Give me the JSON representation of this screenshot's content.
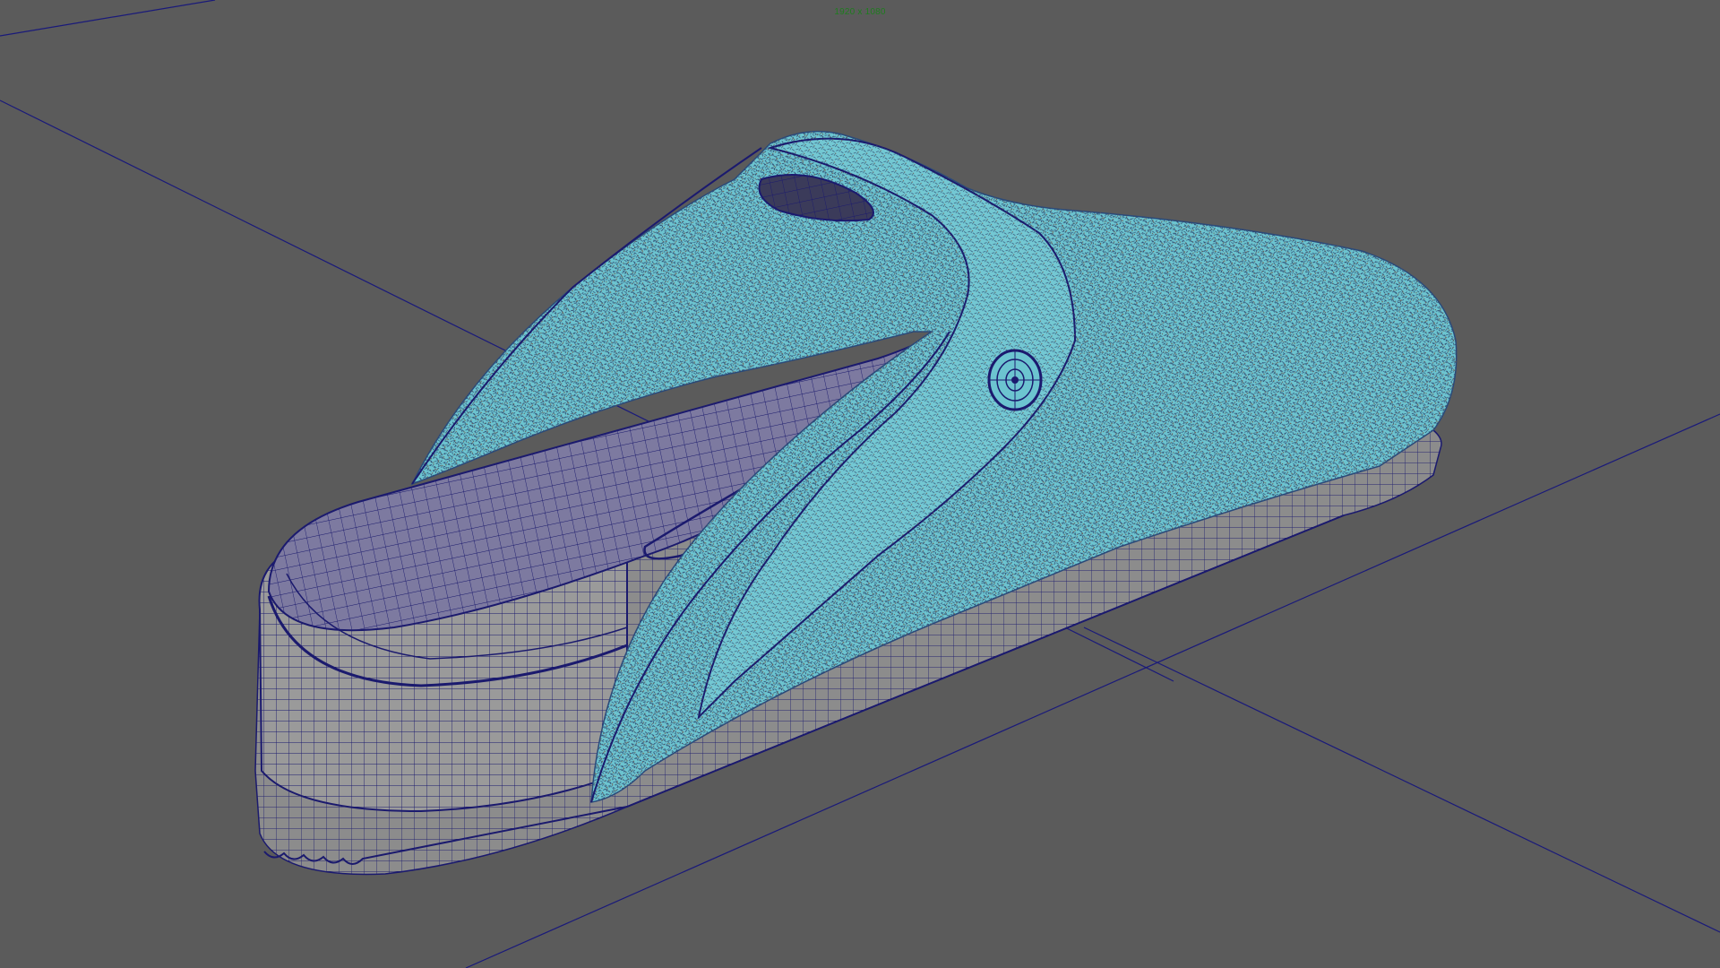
{
  "viewport": {
    "resolution_gate_label": "1920 x 1080",
    "background_color": "#5b5b5b",
    "grid_line_color": "#1a1a7a",
    "wireframe_color": "#1b1a6e",
    "selected_mesh_color": "#6cc4d0",
    "hud_text_color": "#1e7d1e"
  },
  "scene": {
    "object_icon": "clog-shoe-mesh-icon"
  }
}
